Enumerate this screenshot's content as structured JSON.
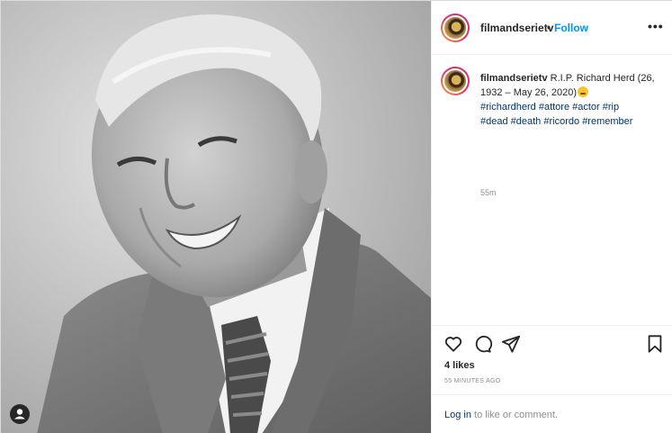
{
  "post": {
    "username": "filmandserietv",
    "follow_separator": "•",
    "follow_label": "Follow",
    "more_label": "•••",
    "caption_username": "filmandserietv",
    "caption_text": "R.I.P. Richard Herd (26, 1932 – May 26, 2020)",
    "hashtags": [
      "#richardherd",
      "#attore",
      "#actor",
      "#rip",
      "#dead",
      "#death",
      "#ricordo",
      "#remember"
    ],
    "caption_time": "55m",
    "likes": "4 likes",
    "time_ago": "55 MINUTES AGO",
    "login_link": "Log in",
    "login_rest": "to like or comment."
  },
  "icons": {
    "like": "heart-icon",
    "comment": "comment-icon",
    "share": "share-icon",
    "save": "bookmark-icon",
    "tagged": "user-tag-icon"
  },
  "colors": {
    "follow_blue": "#0095f6",
    "hashtag_blue": "#00376b",
    "muted_gray": "#8e8e8e"
  }
}
